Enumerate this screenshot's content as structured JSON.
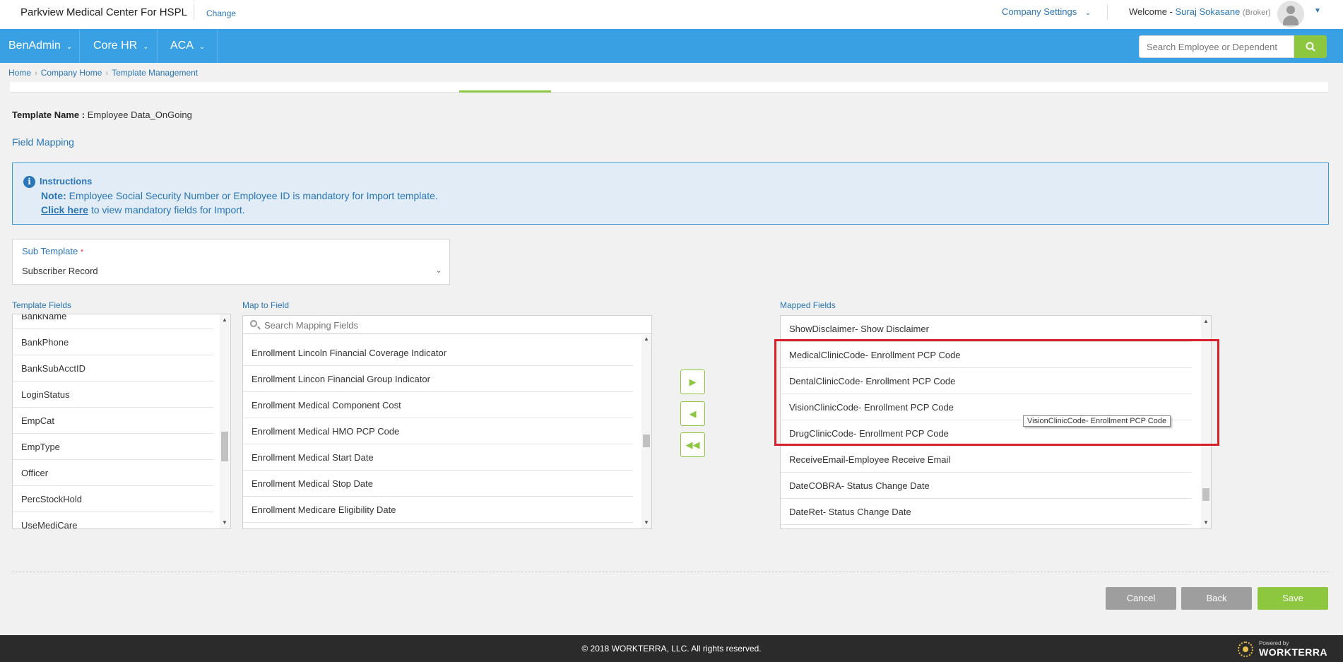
{
  "header": {
    "company": "Parkview Medical Center For HSPL",
    "change": "Change",
    "company_settings": "Company Settings",
    "welcome": "Welcome - ",
    "user": "Suraj Sokasane",
    "role": "(Broker)"
  },
  "nav": {
    "items": [
      "BenAdmin",
      "Core HR",
      "ACA"
    ],
    "search_placeholder": "Search Employee or Dependent"
  },
  "breadcrumb": [
    "Home",
    "Company Home",
    "Template Management"
  ],
  "template": {
    "name_label": "Template Name :",
    "name_value": " Employee Data_OnGoing"
  },
  "field_mapping": "Field Mapping",
  "instructions": {
    "title": "Instructions",
    "note_label": "Note:",
    "note_text": " Employee Social Security Number or Employee ID is mandatory for Import template.",
    "link_text": "Click here",
    "link_suffix": " to view mandatory fields for Import."
  },
  "sub_template": {
    "label": "Sub Template",
    "required": "*",
    "value": "Subscriber Record"
  },
  "template_fields": {
    "label": "Template Fields",
    "items": [
      "BankName",
      "BankPhone",
      "BankSubAcctID",
      "LoginStatus",
      "EmpCat",
      "EmpType",
      "Officer",
      "PercStockHold",
      "UseMediCare"
    ]
  },
  "map_to_field": {
    "label": "Map to Field",
    "search_placeholder": "Search Mapping Fields",
    "items": [
      "Enrollment Lincoln Financial Coverage Indicator",
      "Enrollment Lincon Financial Group Indicator",
      "Enrollment Medical Component Cost",
      "Enrollment Medical HMO PCP Code",
      "Enrollment Medical Start Date",
      "Enrollment Medical Stop Date",
      "Enrollment Medicare Eligibility Date"
    ]
  },
  "mapped_fields": {
    "label": "Mapped Fields",
    "items": [
      "ShowDisclaimer- Show Disclaimer",
      "MedicalClinicCode- Enrollment PCP Code",
      "DentalClinicCode- Enrollment PCP Code",
      "VisionClinicCode- Enrollment PCP Code",
      "DrugClinicCode- Enrollment PCP Code",
      "ReceiveEmail-Employee Receive Email",
      "DateCOBRA- Status Change Date",
      "DateRet- Status Change Date"
    ]
  },
  "tooltip": "VisionClinicCode- Enrollment PCP Code",
  "buttons": {
    "map_right": "▶",
    "map_left": "◀",
    "unmap_all": "◀◀",
    "cancel": "Cancel",
    "back": "Back",
    "save": "Save"
  },
  "footer": {
    "copyright": "© 2018 WORKTERRA, LLC. All rights reserved.",
    "powered_by": "Powered by",
    "brand": "WORKTERRA"
  },
  "icons": {
    "search": "search-icon",
    "info": "info-icon",
    "avatar": "user-avatar-icon",
    "chevron": "chevron-down-icon"
  },
  "colors": {
    "nav_blue": "#3aa0e4",
    "link_blue": "#2a76b8",
    "accent_green": "#8dc63f",
    "highlight_red": "#d6202b",
    "footer_dark": "#2b2b2b"
  }
}
